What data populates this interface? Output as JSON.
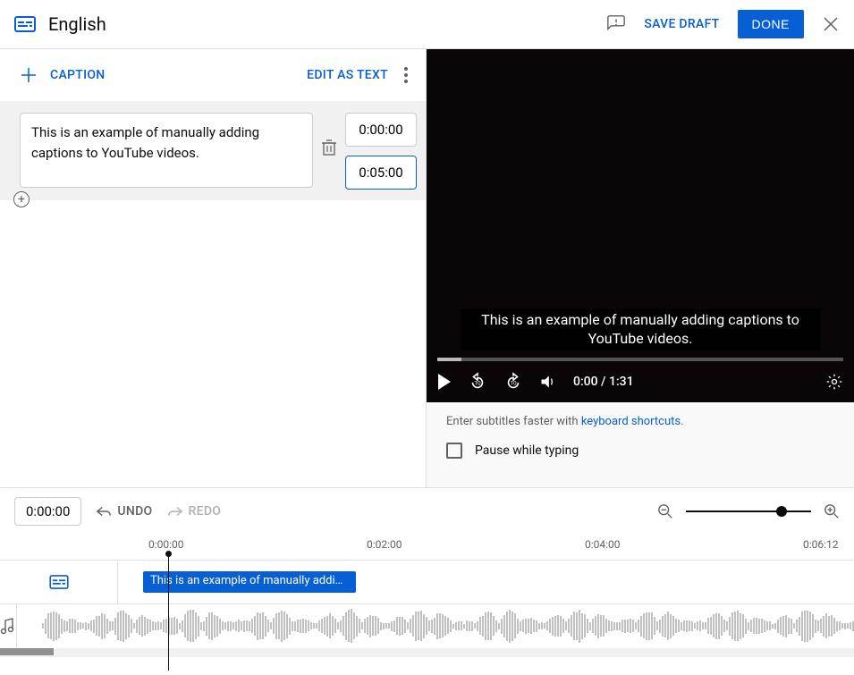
{
  "header": {
    "title": "English",
    "save_draft": "SAVE DRAFT",
    "done": "DONE"
  },
  "left": {
    "caption_btn": "CAPTION",
    "edit_as_text": "EDIT AS TEXT",
    "caption_text": "This is an example of manually adding captions to YouTube videos.",
    "start_time": "0:00:00",
    "end_time": "0:05:00"
  },
  "video": {
    "caption_overlay": "This is an example of manually adding captions to YouTube videos.",
    "time_display": "0:00 / 1:31"
  },
  "hints": {
    "prefix": "Enter subtitles faster with ",
    "link": "keyboard shortcuts",
    "suffix": ".",
    "pause_label": "Pause while typing"
  },
  "timeline": {
    "current": "0:00:00",
    "undo": "UNDO",
    "redo": "REDO",
    "ticks": [
      "0:00:00",
      "0:02:00",
      "0:04:00",
      "0:06:12"
    ],
    "caption_block": "This is an example of manually adding …"
  }
}
